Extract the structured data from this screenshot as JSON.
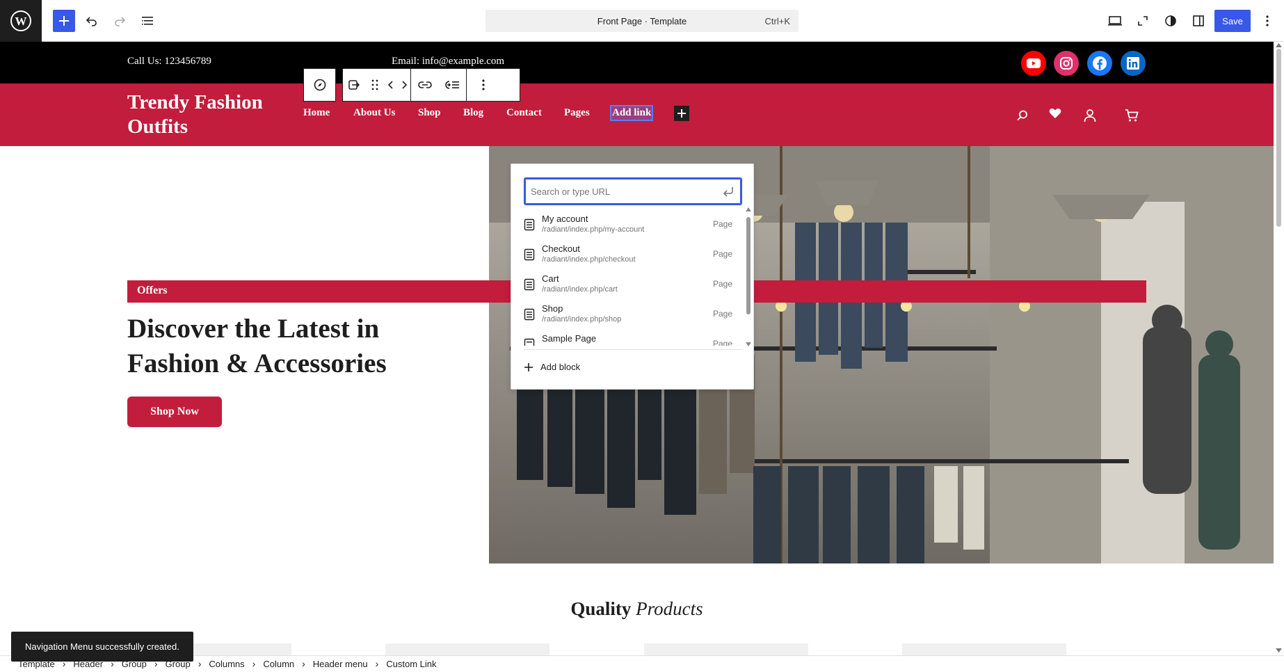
{
  "editor": {
    "title": "Front Page · Template",
    "shortcut": "Ctrl+K",
    "save_label": "Save",
    "inserter_icon": "plus-icon",
    "icons": [
      "wordpress-logo-icon",
      "plus-icon",
      "undo-icon",
      "redo-icon",
      "document-overview-icon",
      "view-desktop-icon",
      "fullscreen-icon",
      "contrast-icon",
      "sidebar-icon",
      "more-vertical-icon"
    ],
    "accent_color": "#3858e9"
  },
  "site": {
    "call": "Call Us: 123456789",
    "email": "Email: info@example.com",
    "title_line1": "Trendy Fashion",
    "title_line2": "Outfits",
    "nav": [
      "Home",
      "About Us",
      "Shop",
      "Blog",
      "Contact",
      "Pages",
      "Add link"
    ],
    "brand_color": "#c21d3c",
    "social": [
      "youtube-icon",
      "instagram-icon",
      "facebook-icon",
      "linkedin-icon"
    ],
    "header_icons": [
      "search-icon",
      "heart-icon",
      "user-icon",
      "cart-icon"
    ]
  },
  "hero": {
    "offers": "Offers",
    "heading_line1": "Discover the Latest in",
    "heading_line2": "Fashion & Accessories",
    "cta": "Shop Now"
  },
  "quality": {
    "bold": "Quality",
    "italic": "Products"
  },
  "link_popover": {
    "placeholder": "Search or type URL",
    "results": [
      {
        "title": "My account",
        "url": "/radiant/index.php/my-account",
        "type": "Page"
      },
      {
        "title": "Checkout",
        "url": "/radiant/index.php/checkout",
        "type": "Page"
      },
      {
        "title": "Cart",
        "url": "/radiant/index.php/cart",
        "type": "Page"
      },
      {
        "title": "Shop",
        "url": "/radiant/index.php/shop",
        "type": "Page"
      },
      {
        "title": "Sample Page",
        "url": "",
        "type": "Page"
      }
    ],
    "add_block": "Add block"
  },
  "snackbar": "Navigation Menu successfully created.",
  "breadcrumbs": [
    "Template",
    "Header",
    "Group",
    "Group",
    "Columns",
    "Column",
    "Header menu",
    "Custom Link"
  ]
}
